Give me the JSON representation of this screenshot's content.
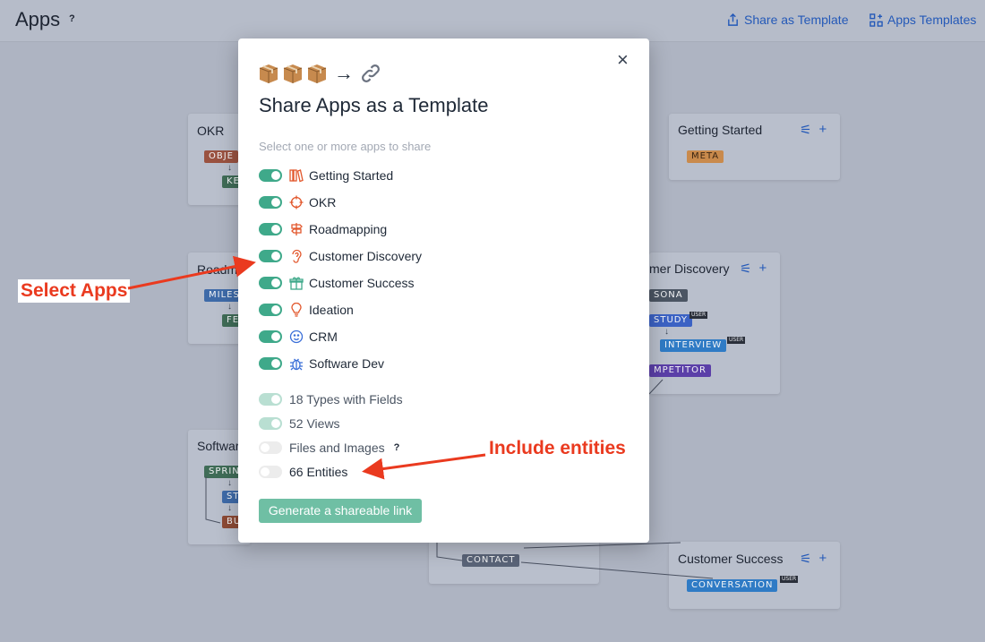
{
  "header": {
    "title": "Apps",
    "help": "?",
    "share_label": "Share as Template",
    "templates_label": "Apps Templates"
  },
  "cards": {
    "okr": {
      "title": "OKR",
      "tags": [
        "OBJE",
        "KE"
      ]
    },
    "roadmapping": {
      "title": "Roadm",
      "tags": [
        "MILES",
        "FE"
      ]
    },
    "software": {
      "title": "Softwar",
      "tags": [
        "SPRIN",
        "ST",
        "BU"
      ]
    },
    "getting_started": {
      "title": "Getting Started",
      "tags": [
        "META"
      ]
    },
    "customer_discovery": {
      "title": "mer Discovery",
      "tags": [
        "SONA",
        "STUDY",
        "INTERVIEW",
        "MPETITOR"
      ],
      "user_badge": "USER"
    },
    "crm": {
      "tags": [
        "CONTACT"
      ]
    },
    "customer_success": {
      "title": "Customer Success",
      "tags": [
        "CONVERSATION"
      ],
      "user_badge": "USER"
    },
    "tools": {
      "settings": "⚟",
      "add": "+"
    }
  },
  "modal": {
    "close": "×",
    "arrow": "→",
    "heading": "Share Apps as a Template",
    "hint": "Select one or more apps to share",
    "apps": [
      {
        "label": "Getting Started",
        "icon": "books-icon",
        "on": true
      },
      {
        "label": "OKR",
        "icon": "crosshair-icon",
        "on": true
      },
      {
        "label": "Roadmapping",
        "icon": "signpost-icon",
        "on": true
      },
      {
        "label": "Customer Discovery",
        "icon": "ear-icon",
        "on": true
      },
      {
        "label": "Customer Success",
        "icon": "gift-icon",
        "on": true
      },
      {
        "label": "Ideation",
        "icon": "lightbulb-icon",
        "on": true
      },
      {
        "label": "CRM",
        "icon": "smiley-icon",
        "on": true
      },
      {
        "label": "Software Dev",
        "icon": "bug-icon",
        "on": true
      }
    ],
    "options": {
      "types": "18 Types with Fields",
      "views": "52 Views",
      "files": "Files and Images",
      "files_help": "?",
      "entities": "66 Entities"
    },
    "generate_label": "Generate a shareable link"
  },
  "annotations": {
    "select_apps": "Select Apps",
    "include_entities": "Include entities"
  },
  "colors": {
    "accent": "#3fa98a",
    "icon_orange": "#e2572c",
    "callout": "#ea3a1f",
    "link": "#2459b8"
  }
}
